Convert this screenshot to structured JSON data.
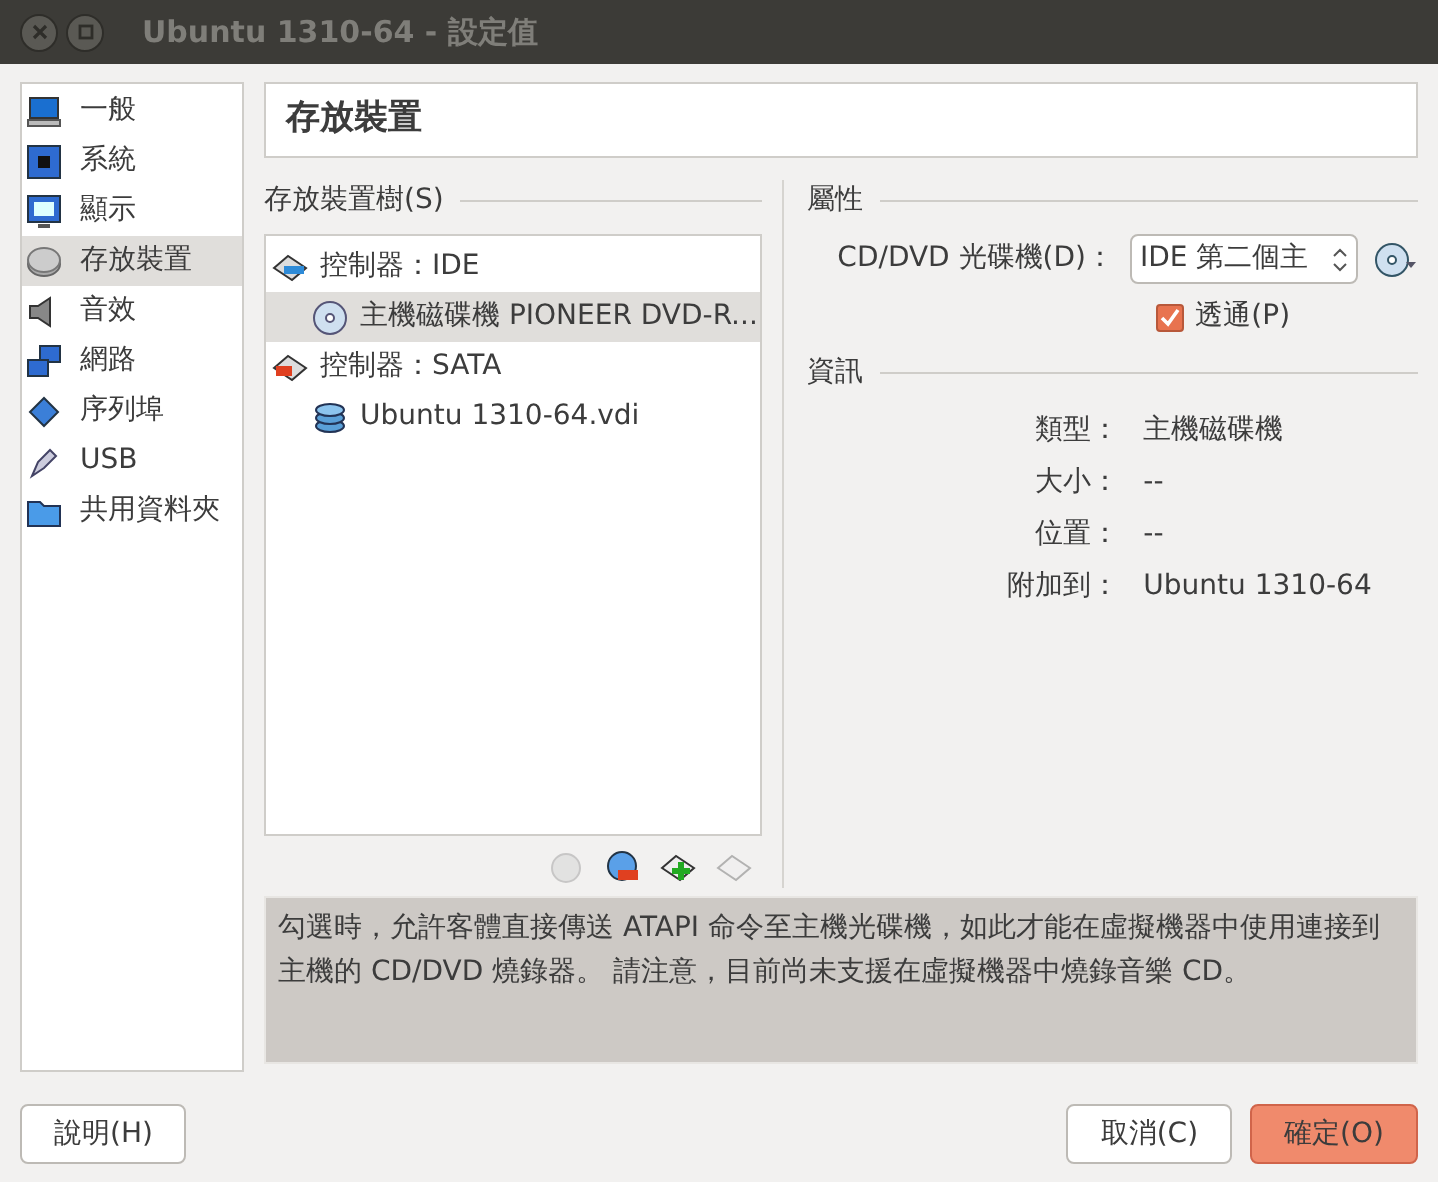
{
  "window": {
    "title": "Ubuntu 1310-64 - 設定值"
  },
  "sidebar": {
    "items": [
      {
        "label": "一般",
        "kind": "monitor",
        "selected": false
      },
      {
        "label": "系統",
        "kind": "chip",
        "selected": false
      },
      {
        "label": "顯示",
        "kind": "display",
        "selected": false
      },
      {
        "label": "存放裝置",
        "kind": "disk",
        "selected": true
      },
      {
        "label": "音效",
        "kind": "speaker",
        "selected": false
      },
      {
        "label": "網路",
        "kind": "network",
        "selected": false
      },
      {
        "label": "序列埠",
        "kind": "serial",
        "selected": false
      },
      {
        "label": "USB",
        "kind": "usb",
        "selected": false
      },
      {
        "label": "共用資料夾",
        "kind": "folder",
        "selected": false
      }
    ]
  },
  "page_title": "存放裝置",
  "storage_tree": {
    "label": "存放裝置樹(S)",
    "items": [
      {
        "label": "控制器：IDE",
        "kind": "ide",
        "selected": false,
        "children": [
          {
            "label": "主機磁碟機 PIONEER DVD-R...",
            "kind": "cd",
            "selected": true
          }
        ]
      },
      {
        "label": "控制器：SATA",
        "kind": "sata",
        "selected": false,
        "children": [
          {
            "label": "Ubuntu 1310-64.vdi",
            "kind": "hdd",
            "selected": false
          }
        ]
      }
    ]
  },
  "tree_toolbar": [
    {
      "kind": "add-attachment",
      "disabled": true
    },
    {
      "kind": "remove-controller",
      "disabled": false
    },
    {
      "kind": "add-controller",
      "disabled": false
    },
    {
      "kind": "remove",
      "disabled": true
    }
  ],
  "attributes": {
    "heading": "屬性",
    "drive_label": "CD/DVD 光碟機(D)：",
    "drive_value": "IDE 第二個主",
    "passthrough": {
      "label": "透通(P)",
      "checked": true
    }
  },
  "info": {
    "heading": "資訊",
    "rows": [
      {
        "label": "類型：",
        "value": "主機磁碟機"
      },
      {
        "label": "大小：",
        "value": "--"
      },
      {
        "label": "位置：",
        "value": "--"
      },
      {
        "label": "附加到：",
        "value": "Ubuntu 1310-64"
      }
    ]
  },
  "description": "勾選時，允許客體直接傳送 ATAPI 命令至主機光碟機，如此才能在虛擬機器中使用連接到主機的 CD/DVD 燒錄器。 請注意，目前尚未支援在虛擬機器中燒錄音樂 CD。",
  "buttons": [
    {
      "label": "說明(H)",
      "kind": "help"
    },
    {
      "label": "取消(C)",
      "kind": "cancel"
    },
    {
      "label": "確定(O)",
      "kind": "ok"
    }
  ]
}
